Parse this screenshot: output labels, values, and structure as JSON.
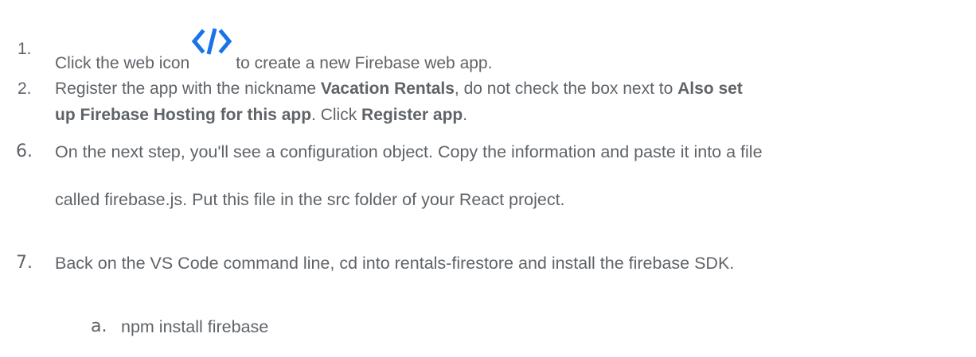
{
  "steps": {
    "s1": {
      "number": "1.",
      "text_before": "Click the web icon",
      "icon": "code-brackets-icon",
      "text_after": "to create a new Firebase web app."
    },
    "s2": {
      "number": "2.",
      "line1_a": "Register the app with the nickname ",
      "line1_bold1": "Vacation Rentals",
      "line1_b": ", do not check the box next to ",
      "line1_bold2": "Also set",
      "line2_bold": "up Firebase Hosting for this app",
      "line2_a": ". Click ",
      "line2_bold2": "Register app",
      "line2_b": "."
    },
    "s6": {
      "number": "6.",
      "line1": "On the next step, you'll see a configuration object. Copy the information and paste it into a file",
      "line2": "called firebase.js. Put this file in the src folder of your React project."
    },
    "s7": {
      "number": "7.",
      "line1": "Back on the VS Code command line, cd into rentals-firestore and install the firebase SDK."
    },
    "s7a": {
      "number": "a.",
      "text": "npm install firebase"
    }
  },
  "colors": {
    "text": "#5f6368",
    "icon": "#1a73e8"
  }
}
